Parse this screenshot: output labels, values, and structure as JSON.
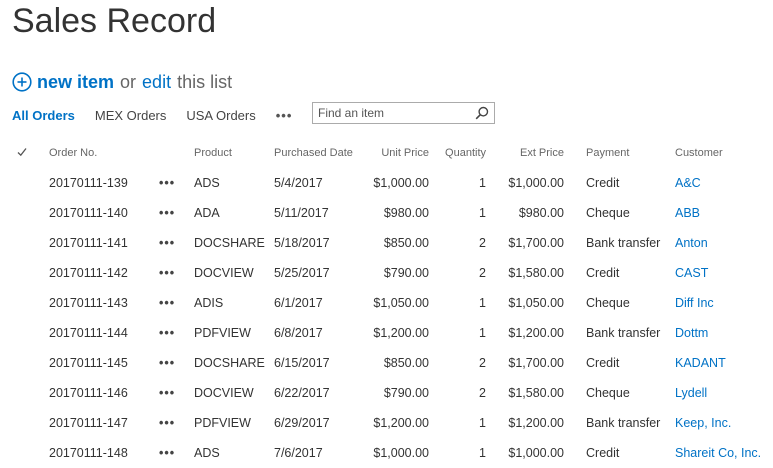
{
  "page": {
    "title": "Sales Record"
  },
  "actions": {
    "new_item": "new item",
    "or": "or",
    "edit": "edit",
    "this_list": "this list"
  },
  "views": {
    "tabs": [
      {
        "label": "All Orders",
        "active": true
      },
      {
        "label": "MEX Orders",
        "active": false
      },
      {
        "label": "USA Orders",
        "active": false
      }
    ],
    "more": "•••"
  },
  "search": {
    "placeholder": "Find an item",
    "value": ""
  },
  "table": {
    "columns": {
      "order": "Order No.",
      "product": "Product",
      "purchased": "Purchased Date",
      "unit_price": "Unit Price",
      "quantity": "Quantity",
      "ext_price": "Ext Price",
      "payment": "Payment",
      "customer": "Customer"
    },
    "row_menu": "•••",
    "rows": [
      {
        "order": "20170111-139",
        "product": "ADS",
        "purchased": "5/4/2017",
        "unit_price": "$1,000.00",
        "quantity": "1",
        "ext_price": "$1,000.00",
        "payment": "Credit",
        "customer": "A&C"
      },
      {
        "order": "20170111-140",
        "product": "ADA",
        "purchased": "5/11/2017",
        "unit_price": "$980.00",
        "quantity": "1",
        "ext_price": "$980.00",
        "payment": "Cheque",
        "customer": "ABB"
      },
      {
        "order": "20170111-141",
        "product": "DOCSHARE",
        "purchased": "5/18/2017",
        "unit_price": "$850.00",
        "quantity": "2",
        "ext_price": "$1,700.00",
        "payment": "Bank transfer",
        "customer": "Anton"
      },
      {
        "order": "20170111-142",
        "product": "DOCVIEW",
        "purchased": "5/25/2017",
        "unit_price": "$790.00",
        "quantity": "2",
        "ext_price": "$1,580.00",
        "payment": "Credit",
        "customer": "CAST"
      },
      {
        "order": "20170111-143",
        "product": "ADIS",
        "purchased": "6/1/2017",
        "unit_price": "$1,050.00",
        "quantity": "1",
        "ext_price": "$1,050.00",
        "payment": "Cheque",
        "customer": "Diff Inc"
      },
      {
        "order": "20170111-144",
        "product": "PDFVIEW",
        "purchased": "6/8/2017",
        "unit_price": "$1,200.00",
        "quantity": "1",
        "ext_price": "$1,200.00",
        "payment": "Bank transfer",
        "customer": "Dottm"
      },
      {
        "order": "20170111-145",
        "product": "DOCSHARE",
        "purchased": "6/15/2017",
        "unit_price": "$850.00",
        "quantity": "2",
        "ext_price": "$1,700.00",
        "payment": "Credit",
        "customer": "KADANT"
      },
      {
        "order": "20170111-146",
        "product": "DOCVIEW",
        "purchased": "6/22/2017",
        "unit_price": "$790.00",
        "quantity": "2",
        "ext_price": "$1,580.00",
        "payment": "Cheque",
        "customer": "Lydell"
      },
      {
        "order": "20170111-147",
        "product": "PDFVIEW",
        "purchased": "6/29/2017",
        "unit_price": "$1,200.00",
        "quantity": "1",
        "ext_price": "$1,200.00",
        "payment": "Bank transfer",
        "customer": "Keep, Inc."
      },
      {
        "order": "20170111-148",
        "product": "ADS",
        "purchased": "7/6/2017",
        "unit_price": "$1,000.00",
        "quantity": "1",
        "ext_price": "$1,000.00",
        "payment": "Credit",
        "customer": "Shareit Co, Inc."
      }
    ]
  },
  "colors": {
    "accent": "#0072c6",
    "text": "#333333",
    "muted": "#666666"
  },
  "icons": {
    "new": "plus-circle-icon",
    "search": "search-icon",
    "select_all": "checkmark-icon"
  }
}
